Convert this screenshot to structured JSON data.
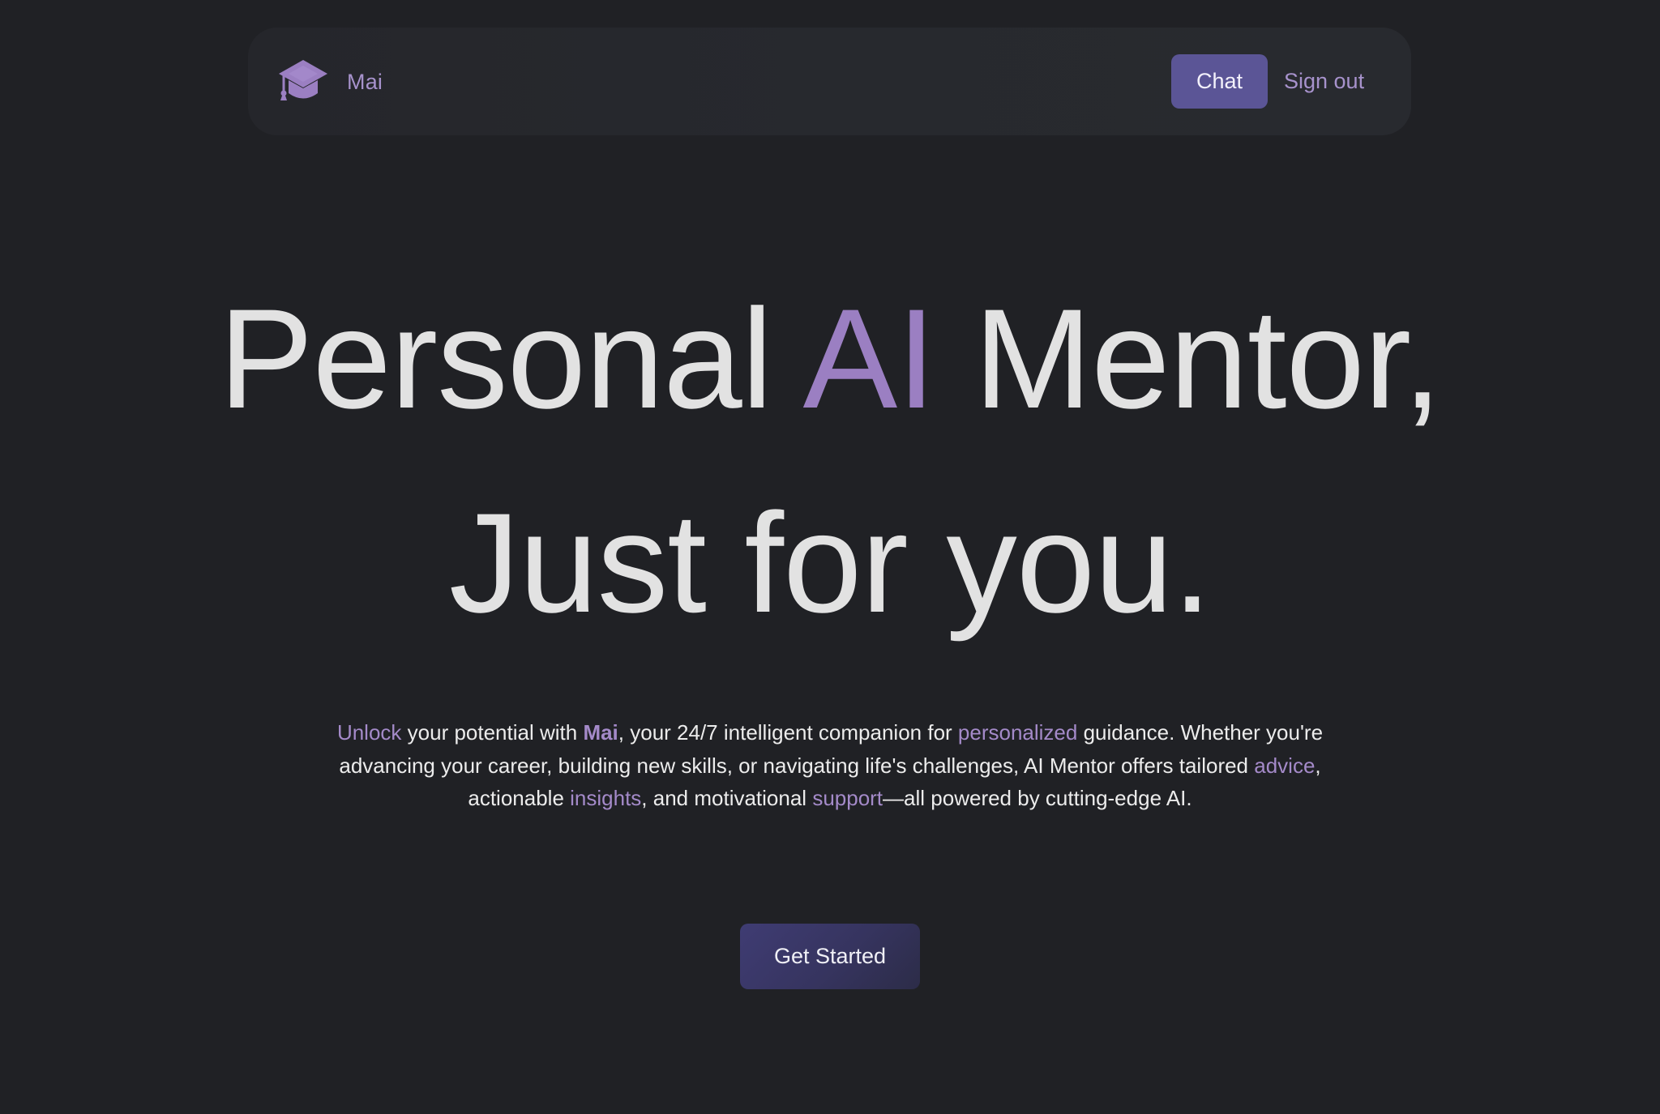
{
  "navbar": {
    "brand_icon": "graduation-cap-icon",
    "brand_name": "Mai",
    "chat_label": "Chat",
    "signout_label": "Sign out"
  },
  "hero": {
    "title": {
      "part1": "Personal ",
      "accent": "AI",
      "part2": " Mentor,",
      "line2": "Just for you."
    },
    "description": {
      "w1": "Unlock",
      "t1": " your potential with ",
      "w2": "Mai",
      "t2": ", your 24/7 intelligent companion for ",
      "w3": "personalized",
      "t3": " guidance. Whether you're advancing your career, building new skills, or navigating life's challenges, AI Mentor offers tailored ",
      "w4": "advice",
      "t4": ", actionable ",
      "w5": "insights",
      "t5": ", and motivational ",
      "w6": "support",
      "t6": "—all powered by cutting-edge AI."
    },
    "cta_label": "Get Started"
  },
  "colors": {
    "background": "#202125",
    "navbar": "#27292e",
    "accent": "#9b7fc2",
    "chat_button": "#5b5596",
    "cta_button": "#3f3c73",
    "title_text": "#e2e2e2"
  }
}
